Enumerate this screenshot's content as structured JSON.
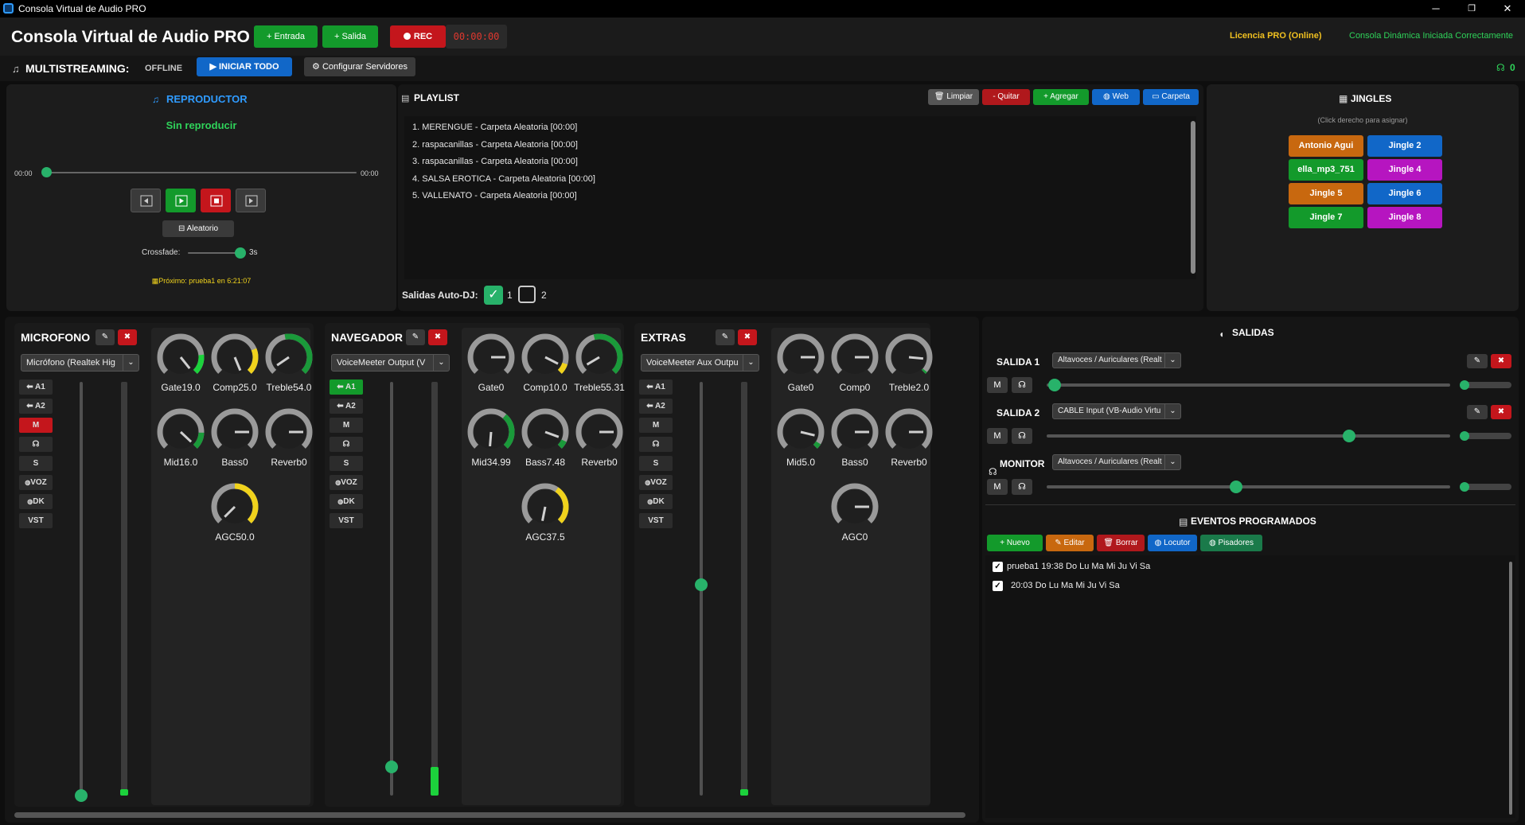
{
  "window": {
    "title": "Consola Virtual de Audio PRO",
    "minimize": "─",
    "maximize": "❐",
    "close": "✕"
  },
  "header": {
    "title": "Consola Virtual de Audio PRO",
    "add_input": "+ Entrada",
    "add_output": "+ Salida",
    "rec_label": "REC",
    "rec_time": "00:00:00",
    "license": "Licencia PRO (Online)",
    "status": "Consola Dinámica Iniciada Correctamente"
  },
  "multistream": {
    "label": "MULTISTREAMING:",
    "state": "OFFLINE",
    "start_all": "▶ INICIAR TODO",
    "configure": "Configurar Servidores",
    "listeners": "0"
  },
  "player": {
    "title": "REPRODUCTOR",
    "now_playing": "Sin reproducir",
    "time_start": "00:00",
    "time_end": "00:00",
    "progress": 0,
    "shuffle": "Aleatorio",
    "crossfade_label": "Crossfade:",
    "crossfade_value": "3s",
    "crossfade_level": 0.8,
    "next": "Próximo: prueba1 en 6:21:07"
  },
  "playlist": {
    "title": "PLAYLIST",
    "buttons": {
      "clear": "Limpiar",
      "remove": "- Quitar",
      "add": "+ Agregar",
      "web": "Web",
      "folder": "Carpeta"
    },
    "items": [
      "1.  MERENGUE - Carpeta Aleatoria  [00:00]",
      "2.  raspacanillas - Carpeta Aleatoria  [00:00]",
      "3.  raspacanillas - Carpeta Aleatoria  [00:00]",
      "4.  SALSA EROTICA - Carpeta Aleatoria  [00:00]",
      "5.  VALLENATO - Carpeta Aleatoria  [00:00]"
    ],
    "autodj_label": "Salidas Auto-DJ:",
    "autodj_outputs": [
      {
        "label": "1",
        "checked": true
      },
      {
        "label": "2",
        "checked": false
      }
    ]
  },
  "jingles": {
    "title": "JINGLES",
    "hint": "(Click derecho para asignar)",
    "items": [
      {
        "label": "Antonio Agui",
        "color": "#c8680f"
      },
      {
        "label": "Jingle 2",
        "color": "#1167c8"
      },
      {
        "label": "ella_mp3_751",
        "color": "#139a2b"
      },
      {
        "label": "Jingle 4",
        "color": "#b615c0"
      },
      {
        "label": "Jingle 5",
        "color": "#c8680f"
      },
      {
        "label": "Jingle 6",
        "color": "#1167c8"
      },
      {
        "label": "Jingle 7",
        "color": "#139a2b"
      },
      {
        "label": "Jingle 8",
        "color": "#b615c0"
      }
    ]
  },
  "routing": {
    "a1": "⬅ A1",
    "a2": "⬅ A2",
    "mute": "M",
    "solo": "S",
    "voz": "VOZ",
    "dk": "DK",
    "vst": "VST"
  },
  "channels": [
    {
      "name": "MICROFONO",
      "device": "Micrófono (Realtek Hig",
      "a1_active": false,
      "mute_active": true,
      "knobs": [
        {
          "label": "Gate19.0",
          "value": 19.0,
          "color": "#1cd23c"
        },
        {
          "label": "Comp25.0",
          "value": 25.0,
          "color": "#f0d21c"
        },
        {
          "label": "Treble54.0",
          "value": 54.0,
          "color": "#1a9a3a"
        },
        {
          "label": "Mid16.0",
          "value": 16.0,
          "color": "#1a9a3a"
        },
        {
          "label": "Bass0",
          "value": 0,
          "color": "#1a9a3a"
        },
        {
          "label": "Reverb0",
          "value": 0,
          "color": "#1a9a3a"
        },
        {
          "label": "AGC50.0",
          "value": 50.0,
          "color": "#f0d21c"
        }
      ],
      "fader": 0.0,
      "meter": 0.0
    },
    {
      "name": "NAVEGADOR",
      "device": "VoiceMeeter Output (V",
      "a1_active": true,
      "mute_active": false,
      "knobs": [
        {
          "label": "Gate0",
          "value": 0,
          "color": "#1a9a3a"
        },
        {
          "label": "Comp10.0",
          "value": 10.0,
          "color": "#f0d21c"
        },
        {
          "label": "Treble55.31",
          "value": 55.31,
          "color": "#1a9a3a"
        },
        {
          "label": "Mid34.99",
          "value": 34.99,
          "color": "#1a9a3a"
        },
        {
          "label": "Bass7.48",
          "value": 7.48,
          "color": "#1a9a3a"
        },
        {
          "label": "Reverb0",
          "value": 0,
          "color": "#1a9a3a"
        },
        {
          "label": "AGC37.5",
          "value": 37.5,
          "color": "#f0d21c"
        }
      ],
      "fader": 0.07,
      "meter": 0.07
    },
    {
      "name": "EXTRAS",
      "device": "VoiceMeeter Aux Outpu",
      "a1_active": false,
      "mute_active": false,
      "knobs": [
        {
          "label": "Gate0",
          "value": 0,
          "color": "#1a9a3a"
        },
        {
          "label": "Comp0",
          "value": 0,
          "color": "#f0d21c"
        },
        {
          "label": "Treble2.0",
          "value": 2.0,
          "color": "#1a9a3a"
        },
        {
          "label": "Mid5.0",
          "value": 5.0,
          "color": "#1a9a3a"
        },
        {
          "label": "Bass0",
          "value": 0,
          "color": "#1a9a3a"
        },
        {
          "label": "Reverb0",
          "value": 0,
          "color": "#1a9a3a"
        },
        {
          "label": "AGC0",
          "value": 0,
          "color": "#f0d21c"
        }
      ],
      "fader": 0.51,
      "meter": 0.0
    }
  ],
  "outputs": {
    "title": "SALIDAS",
    "items": [
      {
        "label": "SALIDA 1",
        "device": "Altavoces / Auriculares (Realt",
        "level": 0.02,
        "meter": 0.02,
        "deletable": true
      },
      {
        "label": "SALIDA 2",
        "device": "CABLE Input (VB-Audio Virtu",
        "level": 0.75,
        "meter": 0.02,
        "deletable": true
      },
      {
        "label": "MONITOR",
        "device": "Altavoces / Auriculares (Realt",
        "level": 0.47,
        "meter": 0.02,
        "deletable": false
      }
    ],
    "mute": "M"
  },
  "events": {
    "title": "EVENTOS PROGRAMADOS",
    "buttons": {
      "new": "+ Nuevo",
      "edit": "Editar",
      "delete": "Borrar",
      "announcer": "Locutor",
      "stepper": "Pisadores"
    },
    "items": [
      {
        "text": "prueba1  19:38  Do Lu Ma Mi Ju Vi Sa",
        "checked": true
      },
      {
        "text": "20:03  Do Lu Ma Mi Ju Vi Sa",
        "checked": true
      }
    ]
  }
}
